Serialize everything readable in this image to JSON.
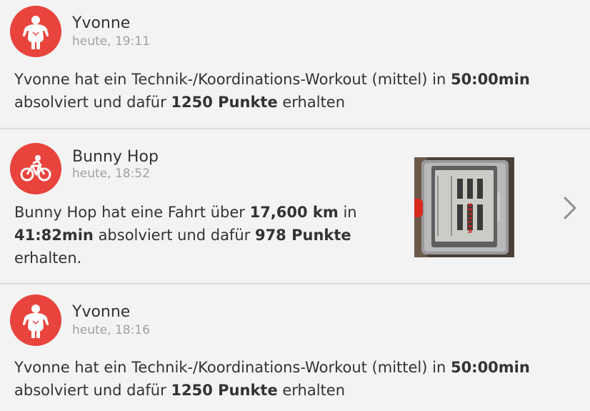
{
  "posts": [
    {
      "author": "Yvonne",
      "time": "heute, 19:11",
      "avatar_icon": "person-icon",
      "parts": {
        "p1": "Yvonne hat ein Technik-/Koordinations-Workout (mittel) in ",
        "b1": "50:00min",
        "p2": " absolviert und dafür ",
        "b2": "1250 Punkte",
        "p3": " erhalten"
      }
    },
    {
      "author": "Bunny Hop",
      "time": "heute, 18:52",
      "avatar_icon": "cyclist-icon",
      "parts": {
        "p1": "Bunny Hop hat eine Fahrt über ",
        "b1": "17,600 km",
        "p2": " in ",
        "b2": "41:82min",
        "p3": " absolviert und dafür ",
        "b3": "978 Punkte",
        "p4": " erhalten."
      },
      "photo_brand": "KETTLER"
    },
    {
      "author": "Yvonne",
      "time": "heute, 18:16",
      "avatar_icon": "person-icon",
      "parts": {
        "p1": "Yvonne hat ein Technik-/Koordinations-Workout (mittel) in ",
        "b1": "50:00min",
        "p2": " absolviert und dafür ",
        "b2": "1250 Punkte",
        "p3": " erhalten"
      }
    }
  ],
  "colors": {
    "accent": "#e8433d",
    "background": "#f3f3f3",
    "text": "#333333",
    "muted": "#a0a0a0",
    "divider": "#dcdcdc"
  }
}
